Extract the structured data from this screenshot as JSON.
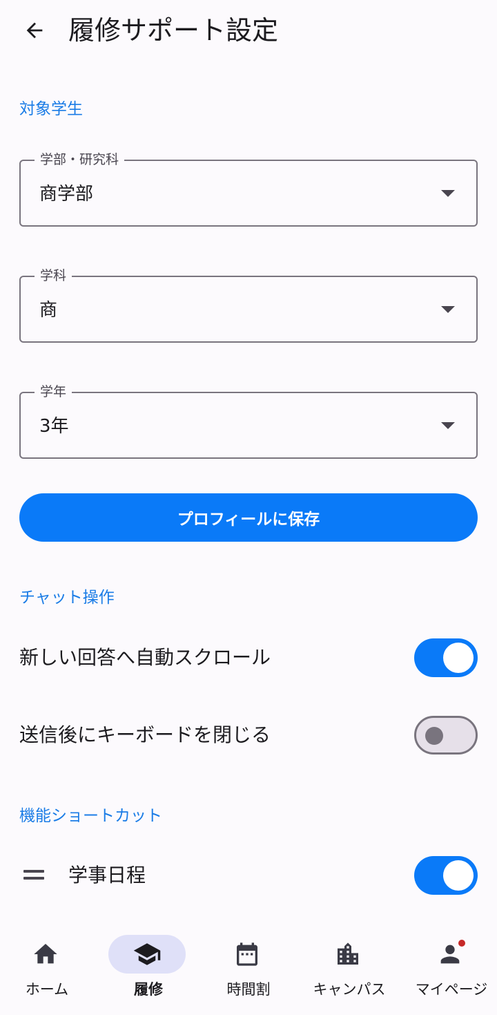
{
  "header": {
    "title": "履修サポート設定"
  },
  "sections": {
    "target": "対象学生",
    "chat": "チャット操作",
    "shortcuts": "機能ショートカット"
  },
  "fields": {
    "faculty": {
      "label": "学部・研究科",
      "value": "商学部"
    },
    "department": {
      "label": "学科",
      "value": "商"
    },
    "year": {
      "label": "学年",
      "value": "3年"
    }
  },
  "save_button": "プロフィールに保存",
  "chat_settings": {
    "auto_scroll": {
      "label": "新しい回答へ自動スクロール",
      "enabled": true
    },
    "close_keyboard": {
      "label": "送信後にキーボードを閉じる",
      "enabled": false
    }
  },
  "shortcut_items": [
    {
      "label": "学事日程",
      "enabled": true
    }
  ],
  "bottom_nav": {
    "items": [
      {
        "label": "ホーム",
        "icon": "home-icon",
        "active": false
      },
      {
        "label": "履修",
        "icon": "graduation-cap-icon",
        "active": true
      },
      {
        "label": "時間割",
        "icon": "calendar-icon",
        "active": false
      },
      {
        "label": "キャンパス",
        "icon": "building-icon",
        "active": false
      },
      {
        "label": "マイページ",
        "icon": "person-icon",
        "active": false,
        "badge": true
      }
    ]
  },
  "colors": {
    "accent": "#0A7AF8",
    "section_label": "#1A7CE6",
    "background": "#FCFAFD",
    "nav_active": "#DFE0F8",
    "badge": "#C62828"
  }
}
